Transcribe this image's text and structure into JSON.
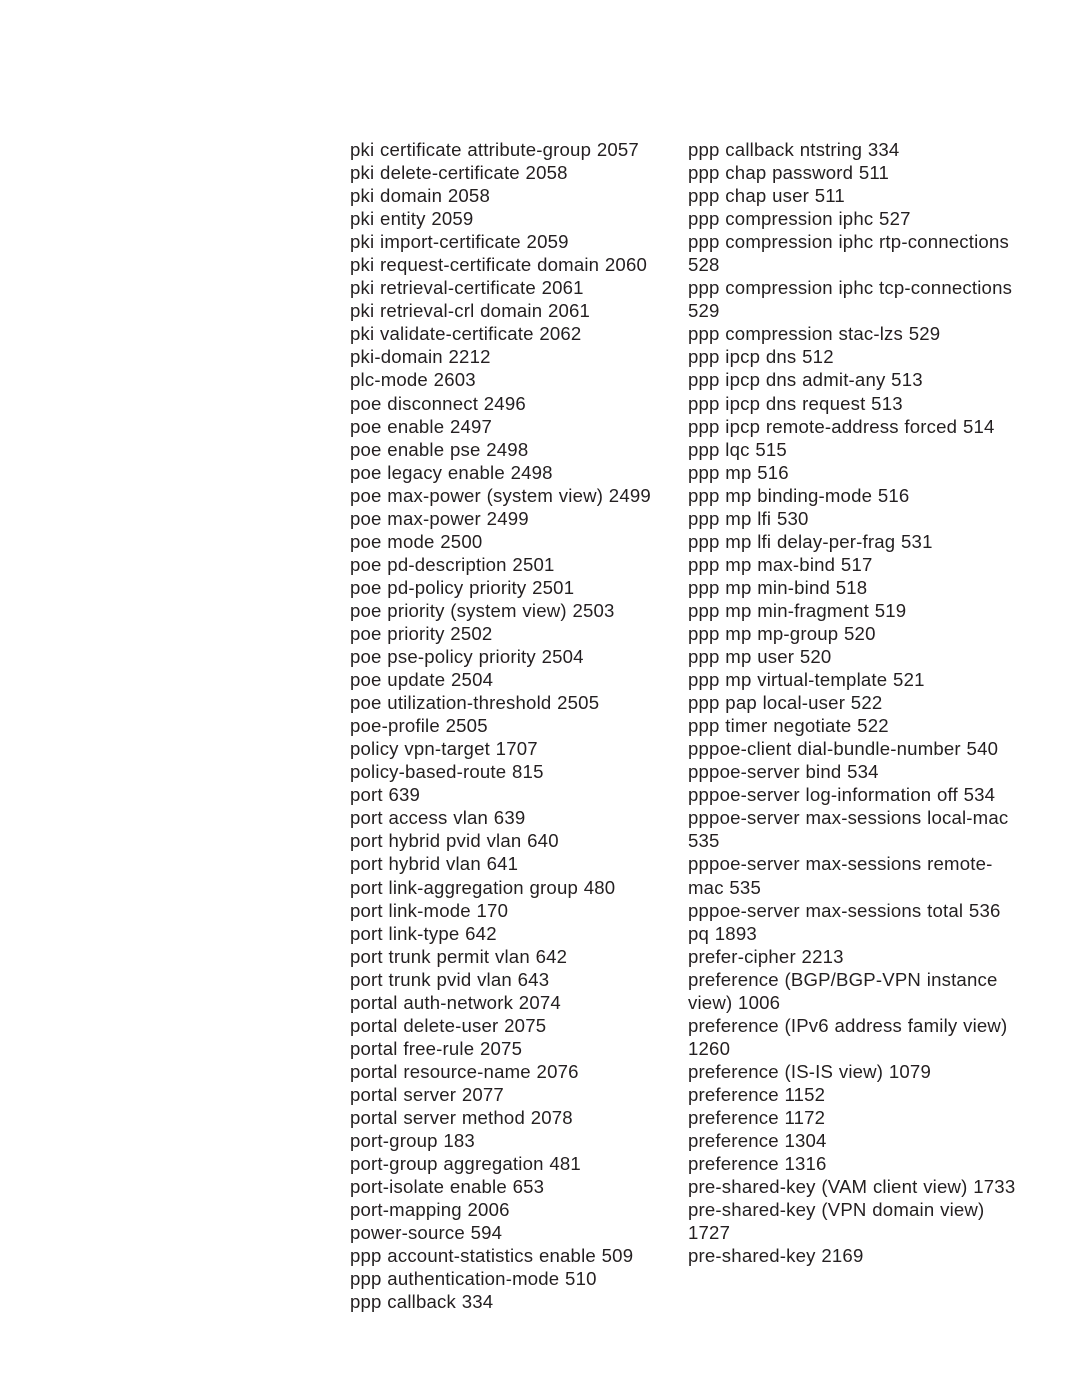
{
  "page": {
    "kind": "book-index",
    "background_color": "#ffffff",
    "text_color": "#231f20",
    "column_count": 2
  },
  "index": {
    "left_column": [
      "pki certificate attribute-group 2057",
      "pki delete-certificate 2058",
      "pki domain 2058",
      "pki entity 2059",
      "pki import-certificate 2059",
      "pki request-certificate domain 2060",
      "pki retrieval-certificate 2061",
      "pki retrieval-crl domain 2061",
      "pki validate-certificate 2062",
      "pki-domain 2212",
      "plc-mode 2603",
      "poe disconnect 2496",
      "poe enable 2497",
      "poe enable pse 2498",
      "poe legacy enable 2498",
      "poe max-power (system view) 2499",
      "poe max-power 2499",
      "poe mode 2500",
      "poe pd-description 2501",
      "poe pd-policy priority 2501",
      "poe priority (system view) 2503",
      "poe priority 2502",
      "poe pse-policy priority 2504",
      "poe update 2504",
      "poe utilization-threshold 2505",
      "poe-profile 2505",
      "policy vpn-target 1707",
      "policy-based-route 815",
      "port 639",
      "port access vlan 639",
      "port hybrid pvid vlan 640",
      "port hybrid vlan 641",
      "port link-aggregation group 480",
      "port link-mode 170",
      "port link-type 642",
      "port trunk permit vlan 642",
      "port trunk pvid vlan 643",
      "portal auth-network 2074",
      "portal delete-user 2075",
      "portal free-rule 2075",
      "portal resource-name 2076",
      "portal server 2077",
      "portal server method 2078",
      "port-group 183",
      "port-group aggregation 481",
      "port-isolate enable 653",
      "port-mapping 2006",
      "power-source 594",
      "ppp account-statistics enable 509",
      "ppp authentication-mode 510",
      "ppp callback 334"
    ],
    "right_column": [
      "ppp callback ntstring 334",
      "ppp chap password 511",
      "ppp chap user 511",
      "ppp compression iphc 527",
      "ppp compression iphc rtp-connections 528",
      "ppp compression iphc tcp-connections 529",
      "ppp compression stac-lzs 529",
      "ppp ipcp dns 512",
      "ppp ipcp dns admit-any 513",
      "ppp ipcp dns request 513",
      "ppp ipcp remote-address forced 514",
      "ppp lqc 515",
      "ppp mp 516",
      "ppp mp binding-mode 516",
      "ppp mp lfi 530",
      "ppp mp lfi delay-per-frag 531",
      "ppp mp max-bind 517",
      "ppp mp min-bind 518",
      "ppp mp min-fragment 519",
      "ppp mp mp-group 520",
      "ppp mp user 520",
      "ppp mp virtual-template 521",
      "ppp pap local-user 522",
      "ppp timer negotiate 522",
      "pppoe-client dial-bundle-number 540",
      "pppoe-server bind 534",
      "pppoe-server log-information off 534",
      "pppoe-server max-sessions local-mac 535",
      "pppoe-server max-sessions remote-mac 535",
      "pppoe-server max-sessions total 536",
      "pq 1893",
      "prefer-cipher 2213",
      "preference (BGP/BGP-VPN instance view) 1006",
      "preference (IPv6 address family view) 1260",
      "preference (IS-IS view) 1079",
      "preference 1152",
      "preference 1172",
      "preference 1304",
      "preference 1316",
      "pre-shared-key (VAM client view) 1733",
      "pre-shared-key (VPN domain view) 1727",
      "pre-shared-key 2169"
    ]
  }
}
